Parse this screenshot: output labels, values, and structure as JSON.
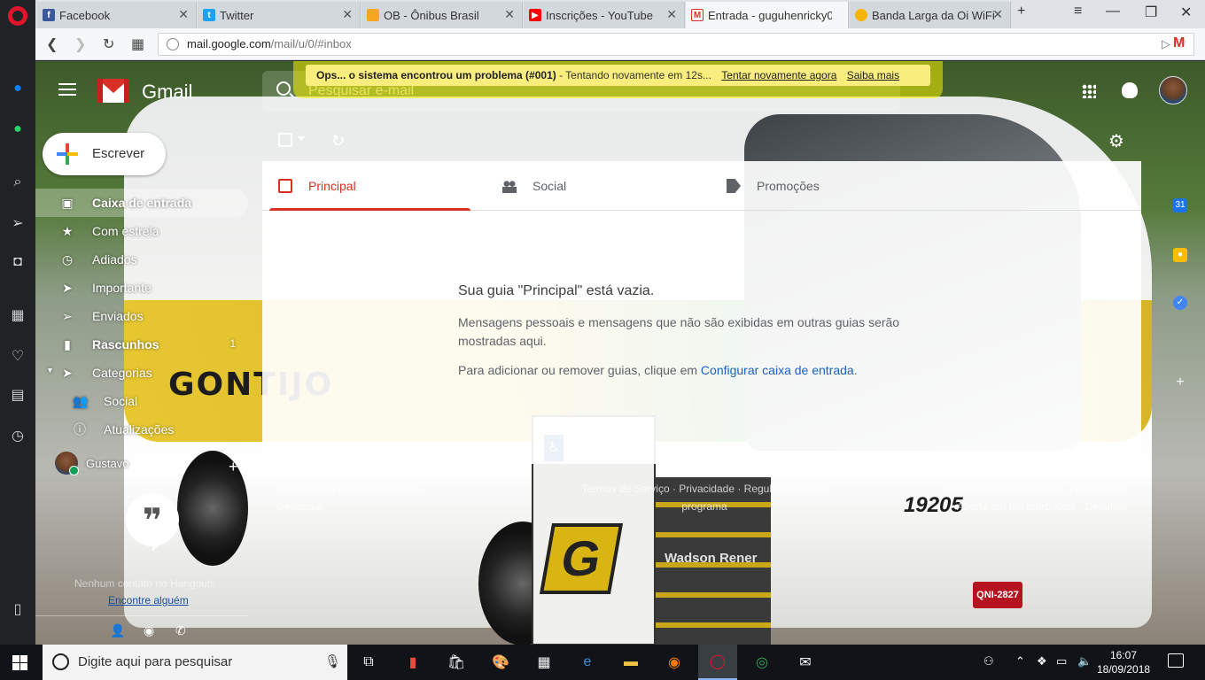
{
  "browser": {
    "tabs": [
      {
        "label": "Facebook",
        "icon": "facebook-icon",
        "color": "#3b5998"
      },
      {
        "label": "Twitter",
        "icon": "twitter-icon",
        "color": "#1da1f2"
      },
      {
        "label": "OB - Ônibus Brasil",
        "icon": "ob-icon",
        "color": "#f5a623"
      },
      {
        "label": "Inscrições - YouTube",
        "icon": "youtube-icon",
        "color": "#ff0000"
      },
      {
        "label": "Entrada - guguhenricky0",
        "icon": "gmail-icon",
        "color": "#d93025"
      },
      {
        "label": "Banda Larga da Oi WiFi",
        "icon": "oi-icon",
        "color": "#f7b500"
      }
    ],
    "url_host": "mail.google.com",
    "url_path": "/mail/u/0/#inbox"
  },
  "gmail": {
    "brand": "Gmail",
    "search_placeholder": "Pesquisar e-mail",
    "error": {
      "title": "Ops... o sistema encontrou um problema (#001)",
      "message": " - Tentando novamente em 12s...",
      "retry_link": "Tentar novamente agora",
      "more_link": "Saiba mais"
    },
    "compose_label": "Escrever",
    "nav": [
      {
        "label": "Caixa de entrada",
        "icon": "inbox-icon",
        "active": true,
        "count": ""
      },
      {
        "label": "Com estrela",
        "icon": "star-icon",
        "count": ""
      },
      {
        "label": "Adiados",
        "icon": "clock-icon",
        "count": ""
      },
      {
        "label": "Importante",
        "icon": "important-icon",
        "count": ""
      },
      {
        "label": "Enviados",
        "icon": "send-icon",
        "count": ""
      },
      {
        "label": "Rascunhos",
        "icon": "draft-icon",
        "count": "1"
      },
      {
        "label": "Categorias",
        "icon": "label-icon",
        "count": ""
      },
      {
        "label": "Social",
        "icon": "people-icon",
        "count": ""
      },
      {
        "label": "Atualizações",
        "icon": "info-icon",
        "count": ""
      }
    ],
    "hangouts": {
      "user_name": "Gustavo",
      "no_contacts": "Nenhum contato no Hangouts",
      "find_someone": "Encontre alguém"
    },
    "categories": [
      {
        "label": "Principal",
        "icon": "inbox-icon",
        "active": true
      },
      {
        "label": "Social",
        "icon": "people-icon"
      },
      {
        "label": "Promoções",
        "icon": "tag-icon"
      }
    ],
    "empty_state": {
      "title": "Sua guia \"Principal\" está vazia.",
      "description": "Mensagens pessoais e mensagens que não são exibidas em outras guias serão mostradas aqui.",
      "hint_prefix": "Para adicionar ou remover guias, clique em ",
      "hint_link": "Configurar caixa de entrada",
      "hint_suffix": "."
    },
    "footer": {
      "storage": "0,3 GB (2%) de 15 GB usados",
      "manage": "Gerenciar",
      "terms": "Termos de Serviço · Privacidade · Regulamentos do programa",
      "last_activity": "Última atividade da conta: Há 1 minuto",
      "open_elsewhere": "Aberta em um outro local · Detalhes"
    }
  },
  "background": {
    "bus_brand": "GONTIJO",
    "bus_number": "19205",
    "plate": "QNI-2827",
    "watermark": "Wadson Rener"
  },
  "taskbar": {
    "search_placeholder": "Digite aqui para pesquisar",
    "time": "16:07",
    "date": "18/09/2018"
  }
}
